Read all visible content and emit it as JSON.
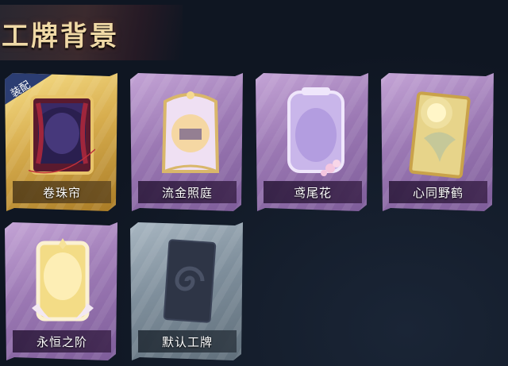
{
  "page": {
    "title": "工牌背景"
  },
  "badge": {
    "equipped": "装配"
  },
  "cards": [
    {
      "label": "卷珠帘",
      "theme": "gold",
      "equipped": true,
      "icon": "curtain-card-art"
    },
    {
      "label": "流金照庭",
      "theme": "purple",
      "equipped": false,
      "icon": "golden-courtyard-card-art"
    },
    {
      "label": "鸢尾花",
      "theme": "purple",
      "equipped": false,
      "icon": "iris-card-art"
    },
    {
      "label": "心同野鹤",
      "theme": "purple",
      "equipped": false,
      "icon": "wild-crane-card-art"
    },
    {
      "label": "永恒之阶",
      "theme": "purple",
      "equipped": false,
      "icon": "eternal-steps-card-art"
    },
    {
      "label": "默认工牌",
      "theme": "gray",
      "equipped": false,
      "icon": "default-badge-card-art"
    }
  ],
  "colors": {
    "background": "#0f1622",
    "title": "#f0d9a6",
    "gold": "#d7ad4e",
    "purple": "#9c79b4",
    "gray": "#7f8f9c",
    "badge": "#2b3d72"
  }
}
